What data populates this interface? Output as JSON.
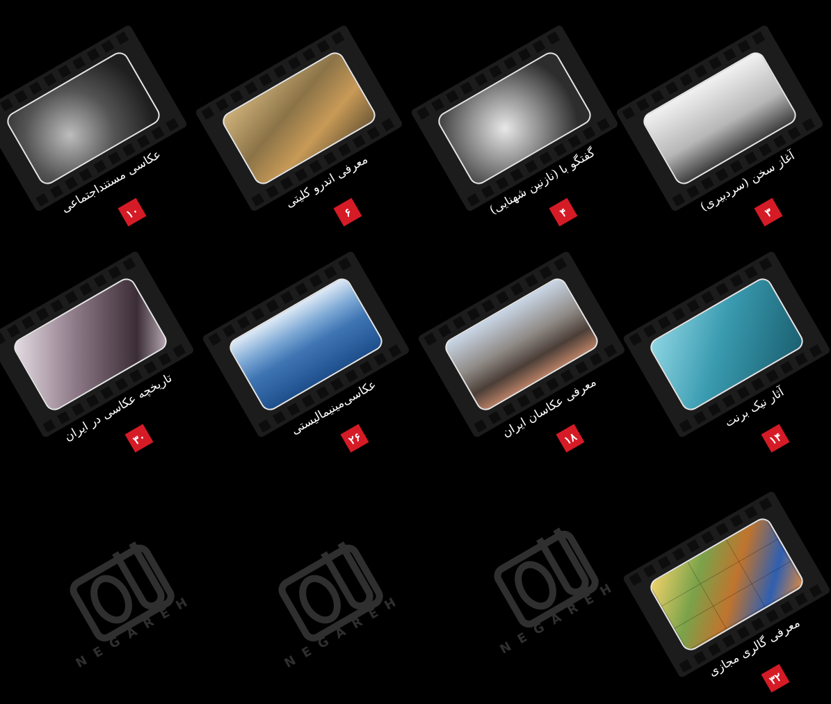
{
  "articles": [
    {
      "title": "عکاسی مستندا‌جتماعی",
      "page": "۱۰",
      "photo": "bw1"
    },
    {
      "title": "معرفی اندرو کلیتی",
      "page": "۶",
      "photo": "war"
    },
    {
      "title": "گفتگو با (نازنین شهنایی)",
      "page": "۴",
      "photo": "woman"
    },
    {
      "title": "آغاز سخن (سردبیری)",
      "page": "۳",
      "photo": "bw2"
    },
    {
      "title": "تاریخچه عکاسی در ایران",
      "page": "۳۰",
      "photo": "history"
    },
    {
      "title": "عکاسی‌مینیمالیستی",
      "page": "۲۶",
      "photo": "mount"
    },
    {
      "title": "معرفی عکاسان ایران",
      "page": "۱۸",
      "photo": "man"
    },
    {
      "title": "آثار نیک برنت",
      "page": "۱۴",
      "photo": "sea"
    },
    {
      "title": "معرفی گالری مجازی",
      "page": "۳۲",
      "photo": "gallery"
    }
  ],
  "placeholder_wordmark": "NEGAREH",
  "colors": {
    "background": "#000000",
    "badge": "#d51b26",
    "film": "#1c1c1c",
    "placeholder": "#2f2f2f"
  }
}
